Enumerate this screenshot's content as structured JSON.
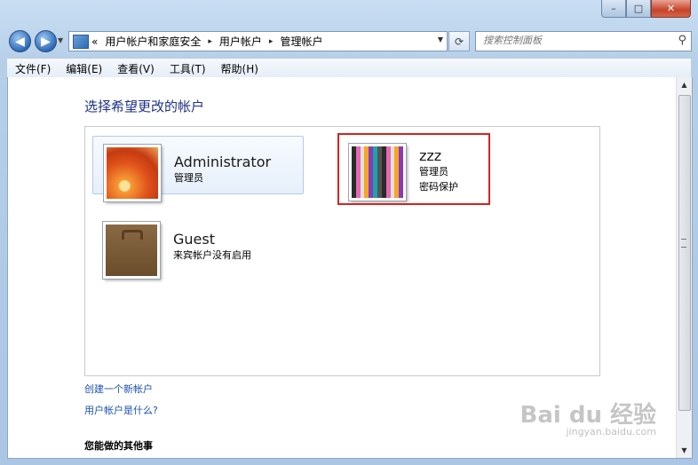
{
  "window": {
    "min_label": "–",
    "max_label": "□",
    "close_label": "✕"
  },
  "nav": {
    "back_icon": "◀",
    "forward_icon": "▶",
    "breadcrumb_prefix": "«",
    "breadcrumbs": [
      "用户帐户和家庭安全",
      "用户帐户",
      "管理帐户"
    ],
    "separator": "▸",
    "search_placeholder": "搜索控制面板"
  },
  "menu": [
    "文件(F)",
    "编辑(E)",
    "查看(V)",
    "工具(T)",
    "帮助(H)"
  ],
  "main": {
    "heading": "选择希望更改的帐户",
    "accounts": [
      {
        "name": "Administrator",
        "lines": [
          "管理员"
        ],
        "icon": "flower-picture"
      },
      {
        "name": "zzz",
        "lines": [
          "管理员",
          "密码保护"
        ],
        "icon": "crayons-picture"
      },
      {
        "name": "Guest",
        "lines": [
          "来宾帐户没有启用"
        ],
        "icon": "suitcase-picture"
      }
    ],
    "links": [
      "创建一个新帐户",
      "用户帐户是什么?"
    ],
    "other_heading": "您能做的其他事"
  },
  "watermark": {
    "brand": "Bai du 经验",
    "url": "jingyan.baidu.com"
  },
  "colors": {
    "highlight": "#d8221f",
    "link": "#1c51b3",
    "heading": "#1e3287"
  }
}
